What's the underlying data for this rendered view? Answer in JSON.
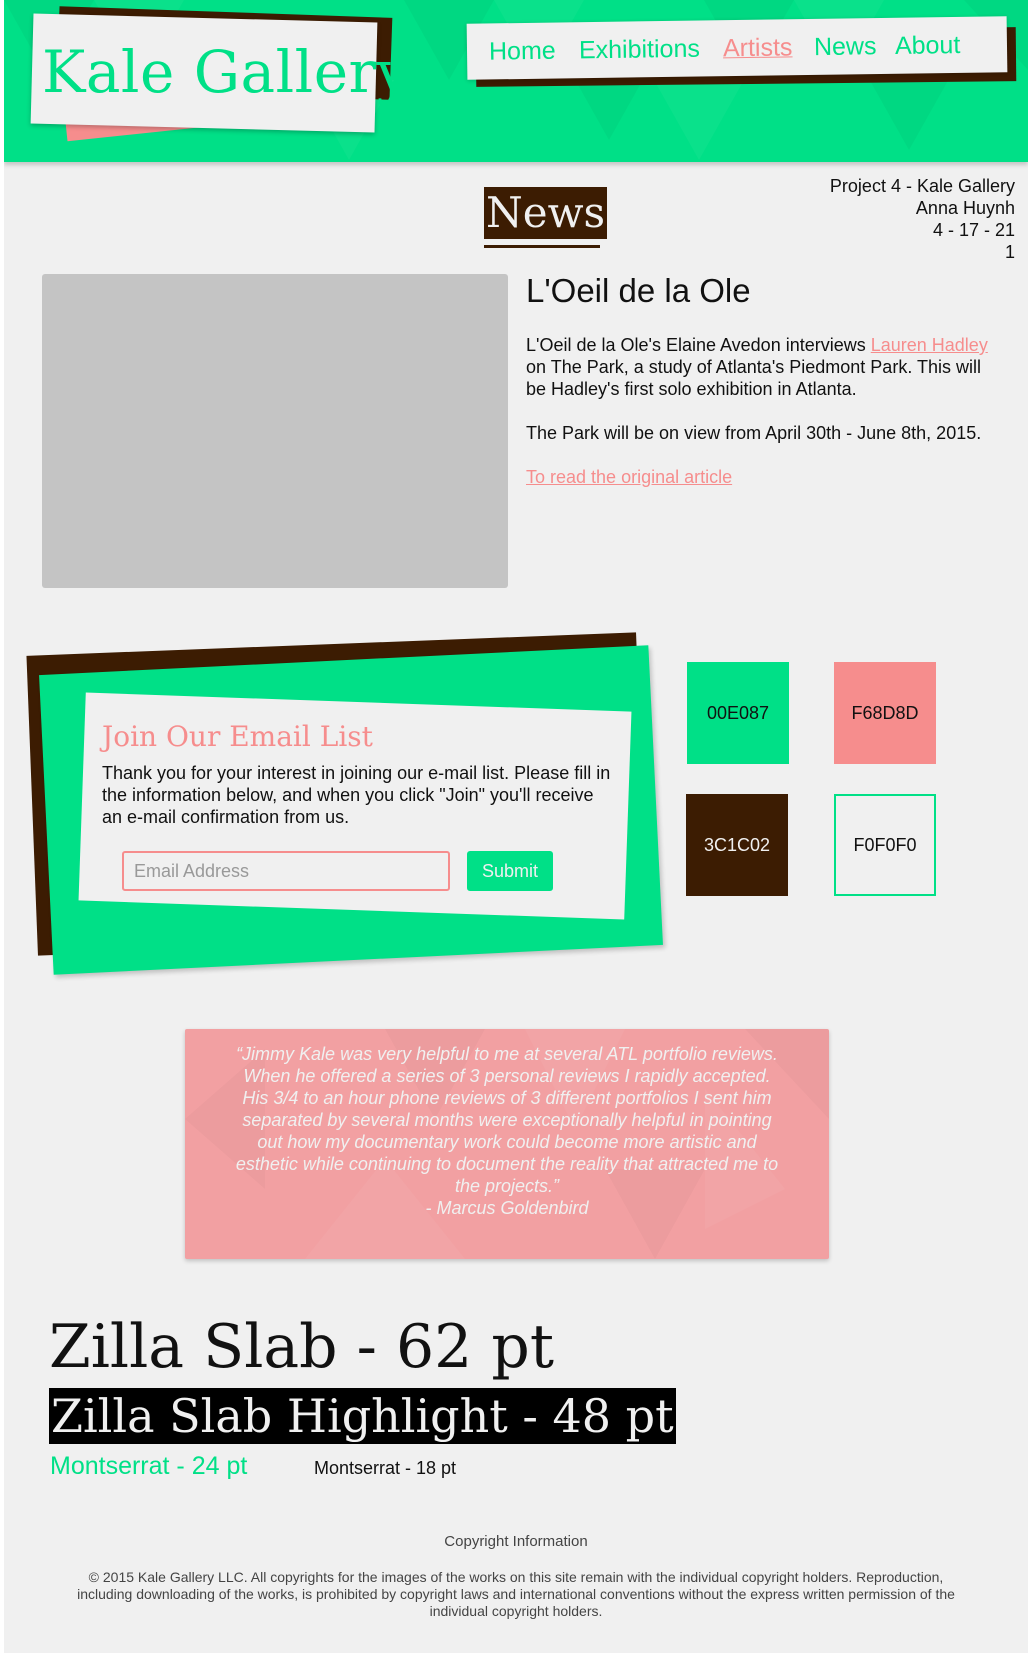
{
  "header": {
    "logo_text": "Kale Gallery",
    "nav": [
      {
        "label": "Home"
      },
      {
        "label": "Exhibitions"
      },
      {
        "label": "Artists"
      },
      {
        "label": "News"
      },
      {
        "label": "About"
      }
    ],
    "active_nav": "Artists"
  },
  "project_info": {
    "line1": "Project 4 - Kale Gallery",
    "line2": "Anna Huynh",
    "line3": "4 - 17 - 21",
    "line4": "1"
  },
  "page_title": "News",
  "article": {
    "title": "L'Oeil de la Ole",
    "p1_before": "L'Oeil de la Ole's Elaine Avedon interviews ",
    "p1_link": "Lauren Hadley",
    "p1_after": " on The Park, a study of Atlanta's Piedmont Park. This will be Hadley's first solo exhibition in Atlanta.",
    "p2": "The Park will be on view from April 30th - June 8th, 2015.",
    "read_link": "To read the original article"
  },
  "email_signup": {
    "title": "Join Our Email List",
    "text": "Thank you for your interest in joining our e-mail list. Please fill in the information below, and when you click \"Join\" you'll receive an e-mail confirmation from us.",
    "input_placeholder": "Email Address",
    "input_value": "",
    "submit_label": "Submit"
  },
  "swatches": [
    {
      "label": "00E087",
      "color": "#00E087"
    },
    {
      "label": "F68D8D",
      "color": "#F68D8D"
    },
    {
      "label": "3C1C02",
      "color": "#3C1C02"
    },
    {
      "label": "F0F0F0",
      "color": "#F0F0F0"
    }
  ],
  "quote": {
    "text": "“Jimmy Kale was very helpful to me at several ATL portfolio reviews. When he offered a series of 3 personal reviews I rapidly accepted. His 3/4 to an hour phone reviews of 3 different portfolios I sent him separated by several months were exceptionally helpful in pointing out how my documentary work could become more artistic and esthetic while continuing to document the reality that attracted me to the projects.”",
    "author": "- Marcus Goldenbird"
  },
  "type_samples": {
    "zilla62": "Zilla Slab - 62 pt",
    "zilla48": "Zilla Slab Highlight - 48 pt",
    "mont24": "Montserrat - 24 pt",
    "mont18": "Montserrat - 18 pt"
  },
  "footer": {
    "heading": "Copyright Information",
    "text": "© 2015 Kale Gallery LLC. All copyrights for the images of the works on this site remain with the individual copyright holders. Reproduction, including downloading of the works, is prohibited by copyright laws and international conventions without the express written permission of the individual copyright holders."
  },
  "colors": {
    "green": "#00E087",
    "pink": "#F68D8D",
    "brown": "#3C1C02",
    "light": "#F0F0F0"
  }
}
